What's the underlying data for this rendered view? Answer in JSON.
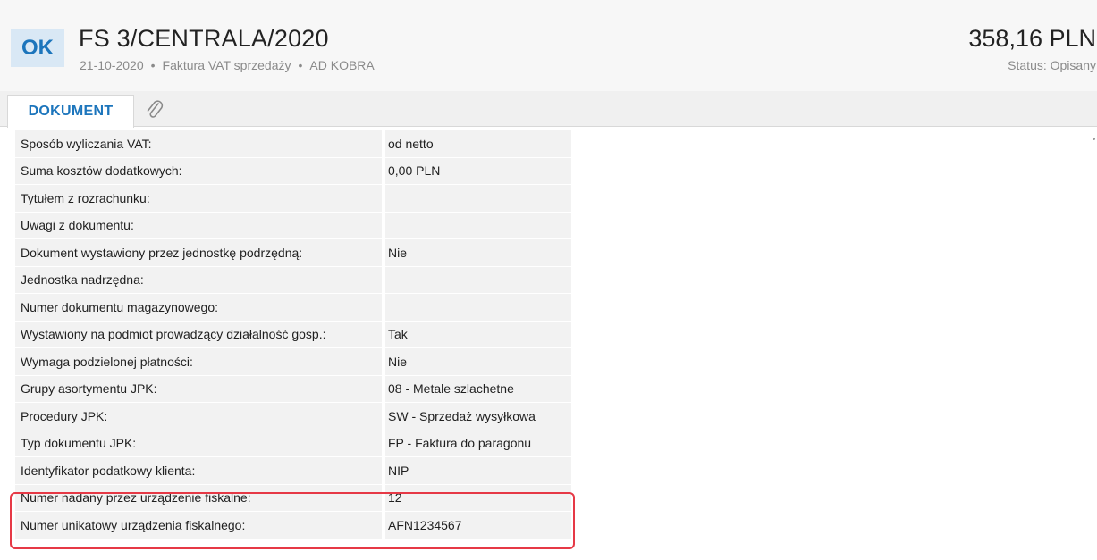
{
  "header": {
    "badge": "OK",
    "title": "FS 3/CENTRALA/2020",
    "date": "21-10-2020",
    "separator": "•",
    "doc_type": "Faktura VAT sprzedaży",
    "contractor": "AD KOBRA",
    "amount": "358,16 PLN",
    "status": "Status: Opisany"
  },
  "tabs": {
    "document_label": "DOKUMENT",
    "attachment_icon": "paperclip-icon"
  },
  "rows": [
    {
      "label": "Sposób wyliczania VAT:",
      "value": "od netto"
    },
    {
      "label": "Suma kosztów dodatkowych:",
      "value": "0,00 PLN"
    },
    {
      "label": "Tytułem z rozrachunku:",
      "value": ""
    },
    {
      "label": "Uwagi z dokumentu:",
      "value": ""
    },
    {
      "label": "Dokument wystawiony przez jednostkę podrzędną:",
      "value": "Nie"
    },
    {
      "label": "Jednostka nadrzędna:",
      "value": ""
    },
    {
      "label": "Numer dokumentu magazynowego:",
      "value": ""
    },
    {
      "label": "Wystawiony na podmiot prowadzący działalność gosp.:",
      "value": "Tak"
    },
    {
      "label": "Wymaga podzielonej płatności:",
      "value": "Nie"
    },
    {
      "label": "Grupy asortymentu JPK:",
      "value": "08 - Metale szlachetne"
    },
    {
      "label": "Procedury JPK:",
      "value": "SW - Sprzedaż wysyłkowa"
    },
    {
      "label": "Typ dokumentu JPK:",
      "value": "FP - Faktura do paragonu"
    },
    {
      "label": "Identyfikator podatkowy klienta:",
      "value": "NIP"
    },
    {
      "label": "Numer nadany przez urządzenie fiskalne:",
      "value": "12"
    },
    {
      "label": "Numer unikatowy urządzenia fiskalnego:",
      "value": "AFN1234567"
    }
  ],
  "colors": {
    "accent": "#1c75bc",
    "highlight": "#e63946"
  }
}
